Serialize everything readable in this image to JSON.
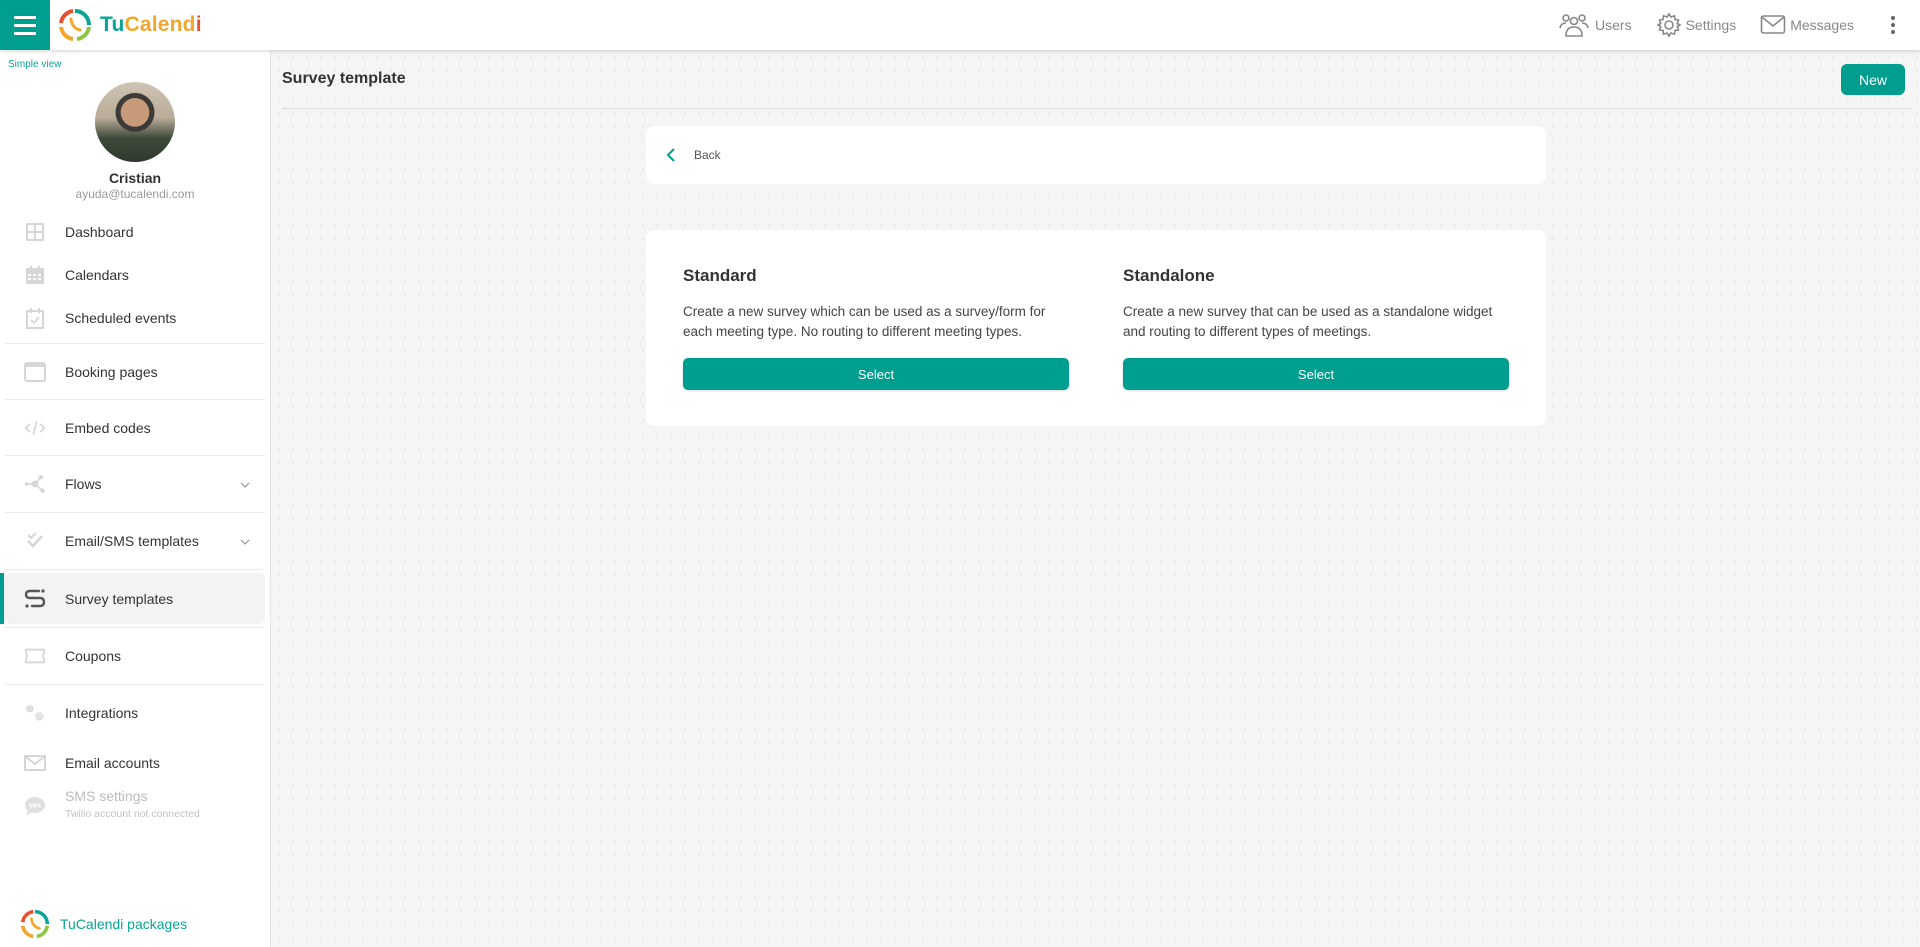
{
  "header": {
    "menu_icon": "hamburger-icon",
    "brand": {
      "part1": "Tu",
      "part2": "Calend",
      "part3": "i"
    },
    "actions": [
      {
        "label": "Users",
        "icon": "users-icon"
      },
      {
        "label": "Settings",
        "icon": "gear-icon"
      },
      {
        "label": "Messages",
        "icon": "envelope-icon"
      }
    ],
    "more_icon": "kebab-menu-icon"
  },
  "sidebar": {
    "simple_view": "Simple view",
    "profile": {
      "name": "Cristian",
      "email": "ayuda@tucalendi.com"
    },
    "items": [
      {
        "label": "Dashboard",
        "icon": "dashboard-icon"
      },
      {
        "label": "Calendars",
        "icon": "calendar-icon"
      },
      {
        "label": "Scheduled events",
        "icon": "calendar-check-icon"
      },
      {
        "label": "Booking pages",
        "icon": "browser-window-icon"
      },
      {
        "label": "Embed codes",
        "icon": "code-icon"
      },
      {
        "label": "Flows",
        "icon": "flows-icon",
        "expandable": true
      },
      {
        "label": "Email/SMS templates",
        "icon": "double-check-icon",
        "expandable": true
      },
      {
        "label": "Survey templates",
        "icon": "survey-icon",
        "active": true
      },
      {
        "label": "Coupons",
        "icon": "ticket-icon"
      },
      {
        "label": "Integrations",
        "icon": "gears-icon"
      },
      {
        "label": "Email accounts",
        "icon": "envelope-icon"
      },
      {
        "label": "SMS settings",
        "icon": "sms-bubble-icon",
        "sublabel": "Twilio account not connected",
        "disabled": true
      }
    ],
    "packages": "TuCalendi packages"
  },
  "main": {
    "title": "Survey template",
    "new_button": "New",
    "back_label": "Back",
    "options": [
      {
        "title": "Standard",
        "description": "Create a new survey which can be used as a survey/form for each meeting type. No routing to different meeting types.",
        "button": "Select"
      },
      {
        "title": "Standalone",
        "description": "Create a new survey that can be used as a standalone widget and routing to different types of meetings.",
        "button": "Select"
      }
    ]
  },
  "colors": {
    "accent": "#009e8e",
    "brand_teal": "#0aa597",
    "brand_orange": "#f2a62b",
    "brand_red": "#e8502f"
  }
}
